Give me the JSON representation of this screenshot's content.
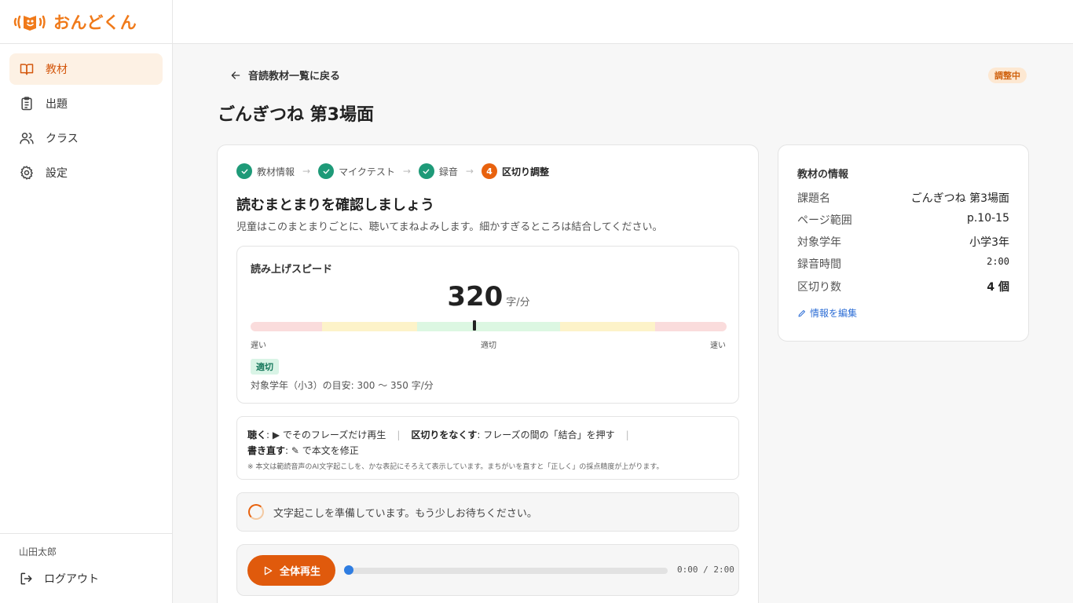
{
  "app": {
    "name": "おんどくん"
  },
  "sidebar": {
    "items": [
      {
        "label": "教材",
        "icon": "book-icon",
        "active": true
      },
      {
        "label": "出題",
        "icon": "clipboard-icon",
        "active": false
      },
      {
        "label": "クラス",
        "icon": "users-icon",
        "active": false
      },
      {
        "label": "設定",
        "icon": "gear-icon",
        "active": false
      }
    ],
    "user_name": "山田太郎",
    "logout_label": "ログアウト"
  },
  "header": {
    "back_label": "音読教材一覧に戻る",
    "status_badge": "調整中",
    "title": "ごんぎつね 第3場面"
  },
  "stepper": {
    "steps": [
      {
        "label": "教材情報",
        "state": "done"
      },
      {
        "label": "マイクテスト",
        "state": "done"
      },
      {
        "label": "録音",
        "state": "done"
      },
      {
        "label": "区切り調整",
        "state": "current",
        "number": "4"
      }
    ]
  },
  "main": {
    "heading": "読むまとまりを確認しましょう",
    "description": "児童はこのまとまりごとに、聴いてまねよみします。細かすぎるところは結合してください。"
  },
  "speed": {
    "title": "読み上げスピード",
    "value": "320",
    "unit": "字/分",
    "label_slow": "遅い",
    "label_ok": "適切",
    "label_fast": "速い",
    "badge": "適切",
    "guide": "対象学年（小3）の目安: 300 〜 350 字/分",
    "marker_fraction": 0.47,
    "zone_colors": [
      "#fadcdc",
      "#fdf3c9",
      "#dcf7e2",
      "#fdf3c9",
      "#fadcdc"
    ]
  },
  "help": {
    "listen_label": "聴く",
    "listen_text": ": ▶ でそのフレーズだけ再生",
    "merge_label": "区切りをなくす",
    "merge_text": ": フレーズの間の「結合」を押す",
    "edit_label": "書き直す",
    "edit_text": ": ✎ で本文を修正",
    "note": "※ 本文は範読音声のAI文字起こしを、かな表記にそろえて表示しています。まちがいを直すと「正しく」の採点精度が上がります。"
  },
  "loading": {
    "text": "文字起こしを準備しています。もう少しお待ちください。"
  },
  "player": {
    "play_label": "全体再生",
    "time": "0:00 / 2:00",
    "progress": 0
  },
  "info": {
    "title": "教材の情報",
    "rows": [
      {
        "key": "課題名",
        "value": "ごんぎつね 第3場面"
      },
      {
        "key": "ページ範囲",
        "value": "p.10-15"
      },
      {
        "key": "対象学年",
        "value": "小学3年"
      },
      {
        "key": "録音時間",
        "value": "2:00"
      },
      {
        "key": "区切り数",
        "value": "4 個"
      }
    ],
    "edit_label": "情報を編集"
  },
  "colors": {
    "accent": "#e8620e",
    "done": "#1e9a78",
    "link": "#2f6fd6"
  }
}
